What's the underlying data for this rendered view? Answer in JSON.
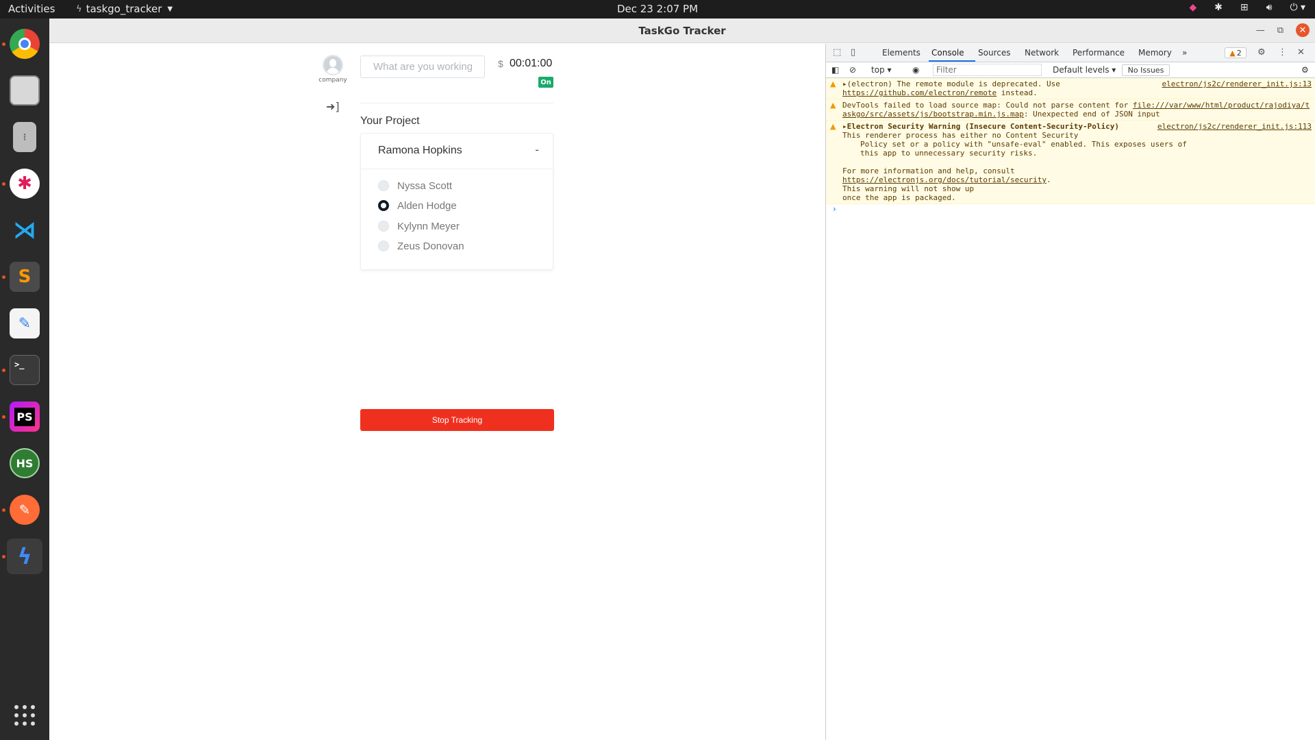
{
  "topbar": {
    "activities": "Activities",
    "app_name": "taskgo_tracker",
    "datetime": "Dec 23  2:07 PM"
  },
  "window": {
    "title": "TaskGo Tracker"
  },
  "app": {
    "avatar_label": "company",
    "task_placeholder": "What are you working on?",
    "currency_symbol": "$",
    "timer": "00:01:00",
    "status_badge": "On",
    "section_title": "Your Project",
    "project": {
      "name": "Ramona Hopkins",
      "toggle": "-",
      "tasks": [
        {
          "label": "Nyssa Scott",
          "checked": false
        },
        {
          "label": "Alden Hodge",
          "checked": true
        },
        {
          "label": "Kylynn Meyer",
          "checked": false
        },
        {
          "label": "Zeus Donovan",
          "checked": false
        }
      ]
    },
    "stop_button": "Stop Tracking"
  },
  "devtools": {
    "tabs": [
      "Elements",
      "Console",
      "Sources",
      "Network",
      "Performance",
      "Memory"
    ],
    "active_tab": "Console",
    "more_tabs": "»",
    "warning_count": "2",
    "context": "top",
    "filter_placeholder": "Filter",
    "levels": "Default levels",
    "issues": "No Issues",
    "messages": {
      "m1_text_a": "(electron) The remote module is deprecated. Use ",
      "m1_link": "https://github.com/electron/remote",
      "m1_text_b": " instead.",
      "m1_src": "electron/js2c/renderer_init.js:13",
      "m2_text_a": "DevTools failed to load source map: Could not parse content for ",
      "m2_link": "file:///var/www/html/product/rajodiya/taskgo/src/assets/js/bootstrap.min.js.map",
      "m2_text_b": ": Unexpected end of JSON input",
      "m3_title": "Electron Security Warning (Insecure Content-Security-Policy)",
      "m3_src": "electron/js2c/renderer_init.js:113",
      "m3_line1": "This renderer process has either no Content Security",
      "m3_line2": "Policy set or a policy with \"unsafe-eval\" enabled. This exposes users of",
      "m3_line3": "this app to unnecessary security risks.",
      "m3_line4": "For more information and help, consult",
      "m3_link": "https://electronjs.org/docs/tutorial/security",
      "m3_line5": "This warning will not show up",
      "m3_line6": "once the app is packaged."
    },
    "prompt": "›"
  },
  "colors": {
    "stop_button": "#f0301f",
    "status_on": "#1aaa6b",
    "devtools_accent": "#1a73e8",
    "warning_bg": "#fffbe5"
  }
}
